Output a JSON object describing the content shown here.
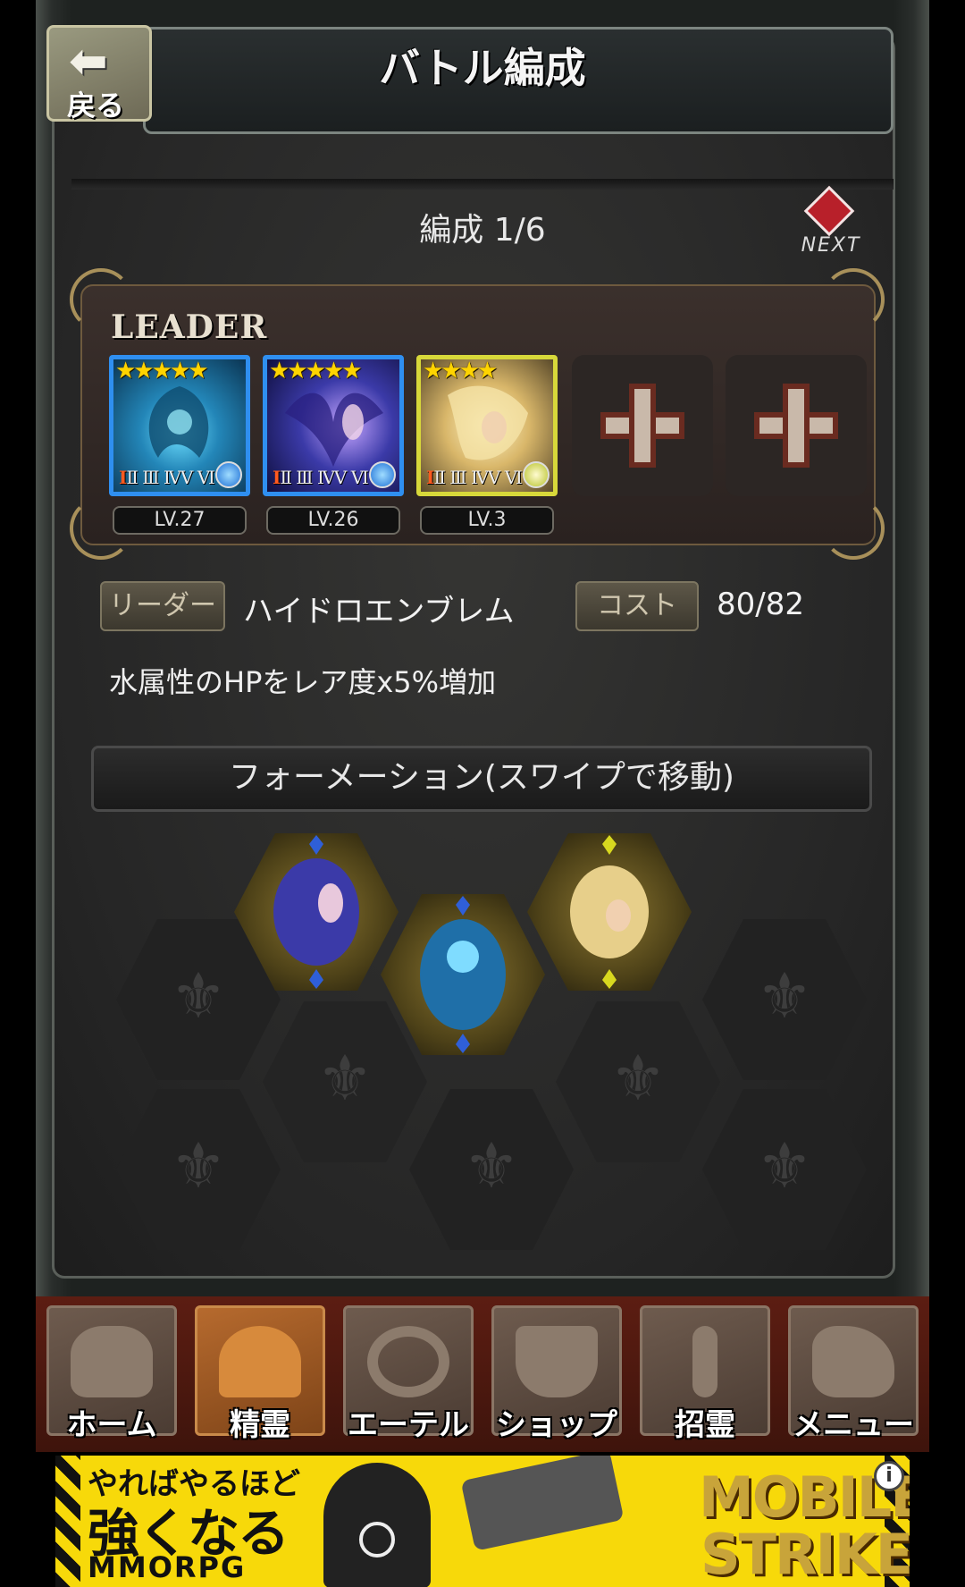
{
  "header": {
    "title": "バトル編成",
    "back_label": "戻る",
    "back_icon": "arrow-left-icon"
  },
  "formation": {
    "count_label": "編成 1/6",
    "next_label": "NEXT"
  },
  "party": {
    "leader_label": "LEADER",
    "cards": [
      {
        "stars": "★★★★★",
        "rank": "Ⅱ Ⅲ ⅣⅤ Ⅵ",
        "rank_first": "Ⅰ",
        "level": "LV.27",
        "element": "water",
        "frame_color": "#2f8ff0"
      },
      {
        "stars": "★★★★★",
        "rank": "Ⅱ Ⅲ ⅣⅤ Ⅵ",
        "rank_first": "Ⅰ",
        "level": "LV.26",
        "element": "water",
        "frame_color": "#2f8ff0"
      },
      {
        "stars": "★★★★",
        "rank": "Ⅱ Ⅲ ⅣⅤ Ⅵ",
        "rank_first": "Ⅰ",
        "level": "LV.3",
        "element": "light",
        "frame_color": "#d7d83a"
      }
    ],
    "empty_slots": 2
  },
  "info": {
    "leader_tag": "リーダー",
    "leader_skill": "ハイドロエンブレム",
    "cost_tag": "コスト",
    "cost_value": "80/82",
    "skill_desc": "水属性のHPをレア度x5%増加"
  },
  "formation_bar": {
    "label": "フォーメーション(スワイプで移動)"
  },
  "nav": [
    {
      "label": "ホーム",
      "icon": "helmet-icon",
      "active": false
    },
    {
      "label": "精霊",
      "icon": "spirit-icon",
      "active": true
    },
    {
      "label": "エーテル",
      "icon": "ring-icon",
      "active": false
    },
    {
      "label": "ショップ",
      "icon": "bag-icon",
      "active": false
    },
    {
      "label": "招霊",
      "icon": "ankh-icon",
      "active": false
    },
    {
      "label": "メニュー",
      "icon": "hand-icon",
      "active": false
    }
  ],
  "ad": {
    "line1": "やればやるほど",
    "line2": "強くなる",
    "line3": "MMORPG",
    "brand1": "MOBILE",
    "brand2": "STRIKE",
    "info_glyph": "i"
  }
}
